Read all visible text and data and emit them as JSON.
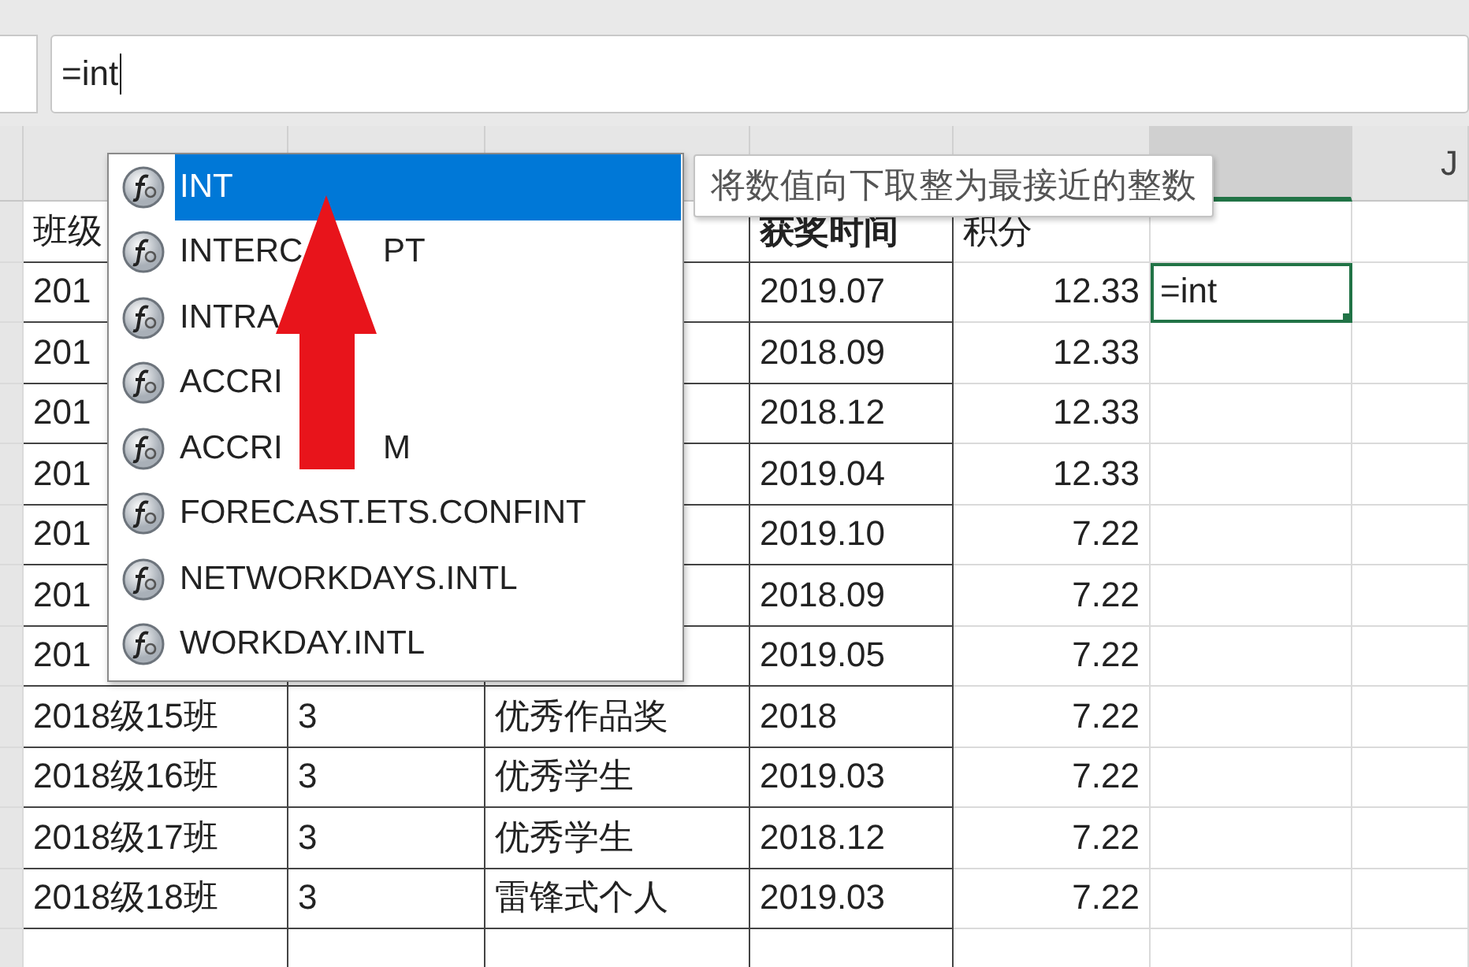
{
  "formula_bar": {
    "value": "=int"
  },
  "column_headers": [
    {
      "selected": true
    },
    {
      "label": "J",
      "selected": false
    }
  ],
  "header": {
    "class": "班级",
    "award_time": "获奖时间",
    "points": "积分"
  },
  "rows": [
    {
      "class": "201",
      "award_time": "2019.07",
      "points": "12.33",
      "column_6": "=int",
      "selected": true
    },
    {
      "class": "201",
      "award_time": "2018.09",
      "points": "12.33",
      "selected": false
    },
    {
      "class": "201",
      "award_time": "2018.12",
      "points": "12.33",
      "selected": false
    },
    {
      "class": "201",
      "award_time": "2019.04",
      "points": "12.33",
      "selected": false
    },
    {
      "class": "201",
      "award_time": "2019.10",
      "points": "7.22",
      "selected": false
    },
    {
      "class": "201",
      "award_time": "2018.09",
      "points": "7.22",
      "selected": false
    },
    {
      "class": "201",
      "award_time": "2019.05",
      "points": "7.22",
      "selected": false
    },
    {
      "class": "2018级15班",
      "column_2": "3",
      "column_3": "优秀作品奖",
      "award_time": "2018",
      "points": "7.22",
      "selected": false
    },
    {
      "class": "2018级16班",
      "column_2": "3",
      "column_3": "优秀学生",
      "award_time": "2019.03",
      "points": "7.22",
      "selected": false
    },
    {
      "class": "2018级17班",
      "column_2": "3",
      "column_3": "优秀学生",
      "award_time": "2018.12",
      "points": "7.22",
      "selected": false
    },
    {
      "class": "2018级18班",
      "column_2": "3",
      "column_3": "雷锋式个人",
      "award_time": "2019.03",
      "points": "7.22",
      "selected": false
    }
  ],
  "autocomplete": {
    "items": [
      {
        "label": "INT",
        "selected": true
      },
      {
        "label": "INTERC",
        "tail": "PT",
        "selected": false
      },
      {
        "label": "INTRA",
        "selected": false
      },
      {
        "label": "ACCRI",
        "selected": false
      },
      {
        "label": "ACCRI",
        "tail": "M",
        "selected": false
      },
      {
        "label": "FORECAST.ETS.CONFINT",
        "selected": false
      },
      {
        "label": "NETWORKDAYS.INTL",
        "selected": false
      },
      {
        "label": "WORKDAY.INTL",
        "selected": false
      }
    ]
  },
  "tooltip": {
    "text": "将数值向下取整为最接近的整数"
  }
}
